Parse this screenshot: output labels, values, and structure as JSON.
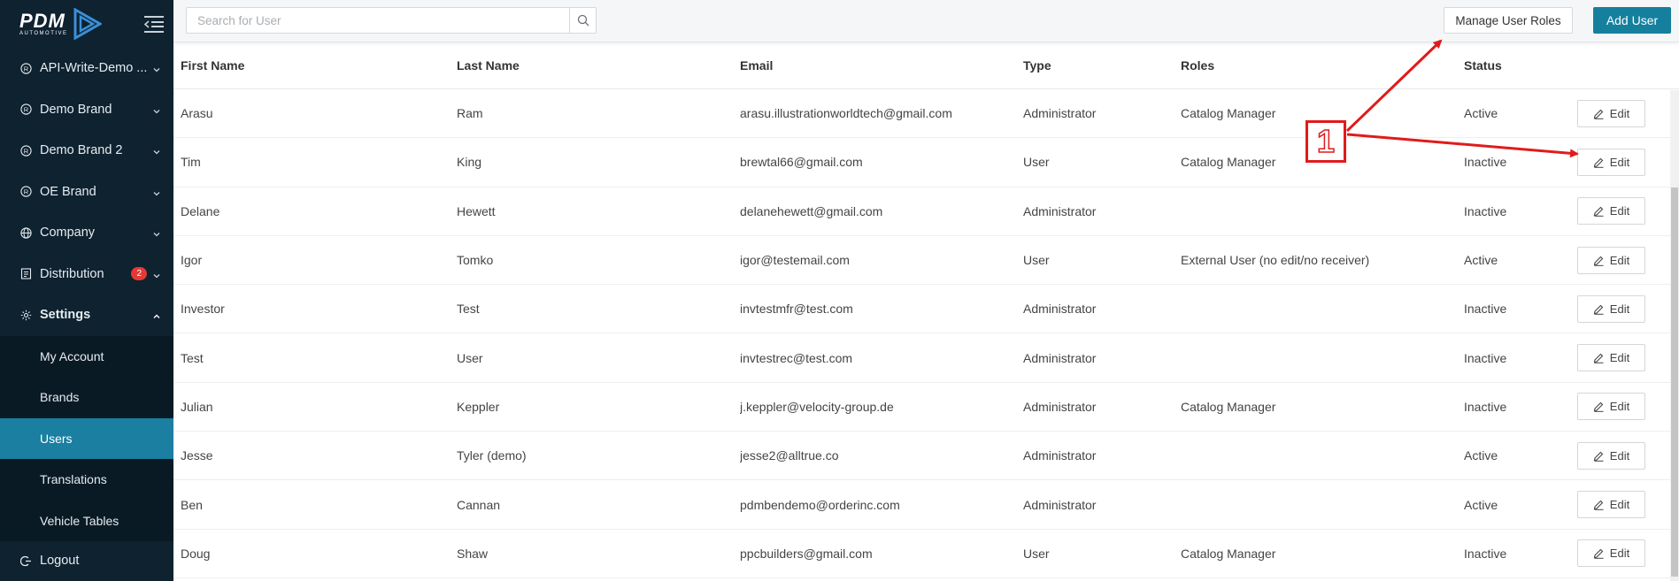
{
  "brand": {
    "logo_text": "PDM",
    "logo_sub": "AUTOMOTIVE"
  },
  "sidebar": {
    "items": [
      {
        "label": "API-Write-Demo ...",
        "icon": "registered-icon"
      },
      {
        "label": "Demo Brand",
        "icon": "registered-icon"
      },
      {
        "label": "Demo Brand 2",
        "icon": "registered-icon"
      },
      {
        "label": "OE Brand",
        "icon": "registered-icon"
      },
      {
        "label": "Company",
        "icon": "globe-icon"
      },
      {
        "label": "Distribution",
        "icon": "document-icon",
        "badge": "2"
      },
      {
        "label": "Settings",
        "icon": "gear-icon"
      }
    ],
    "settings_sub": [
      {
        "label": "My Account"
      },
      {
        "label": "Brands"
      },
      {
        "label": "Users",
        "active": true
      },
      {
        "label": "Translations"
      },
      {
        "label": "Vehicle Tables"
      }
    ],
    "logout": "Logout"
  },
  "header": {
    "search_placeholder": "Search for User",
    "manage_roles": "Manage User Roles",
    "add_user": "Add User"
  },
  "table": {
    "columns": [
      "First Name",
      "Last Name",
      "Email",
      "Type",
      "Roles",
      "Status"
    ],
    "rows": [
      {
        "first": "Arasu",
        "last": "Ram",
        "email": "arasu.illustrationworldtech@gmail.com",
        "type": "Administrator",
        "roles": "Catalog Manager",
        "status": "Active"
      },
      {
        "first": "Tim",
        "last": "King",
        "email": "brewtal66@gmail.com",
        "type": "User",
        "roles": "Catalog Manager",
        "status": "Inactive"
      },
      {
        "first": "Delane",
        "last": "Hewett",
        "email": "delanehewett@gmail.com",
        "type": "Administrator",
        "roles": "",
        "status": "Inactive"
      },
      {
        "first": "Igor",
        "last": "Tomko",
        "email": "igor@testemail.com",
        "type": "User",
        "roles": "External User (no edit/no receiver)",
        "status": "Active"
      },
      {
        "first": "Investor",
        "last": "Test",
        "email": "invtestmfr@test.com",
        "type": "Administrator",
        "roles": "",
        "status": "Inactive"
      },
      {
        "first": "Test",
        "last": "User",
        "email": "invtestrec@test.com",
        "type": "Administrator",
        "roles": "",
        "status": "Inactive"
      },
      {
        "first": "Julian",
        "last": "Keppler",
        "email": "j.keppler@velocity-group.de",
        "type": "Administrator",
        "roles": "Catalog Manager",
        "status": "Inactive"
      },
      {
        "first": "Jesse",
        "last": "Tyler (demo)",
        "email": "jesse2@alltrue.co",
        "type": "Administrator",
        "roles": "",
        "status": "Active"
      },
      {
        "first": "Ben",
        "last": "Cannan",
        "email": "pdmbendemo@orderinc.com",
        "type": "Administrator",
        "roles": "",
        "status": "Active"
      },
      {
        "first": "Doug",
        "last": "Shaw",
        "email": "ppcbuilders@gmail.com",
        "type": "User",
        "roles": "Catalog Manager",
        "status": "Inactive"
      }
    ],
    "edit_label": "Edit"
  },
  "annotation": {
    "number": "1",
    "color": "#e01b1b"
  },
  "colors": {
    "sidebar_bg": "#0e2230",
    "accent": "#15809e",
    "active_item": "#1a7fa0"
  }
}
